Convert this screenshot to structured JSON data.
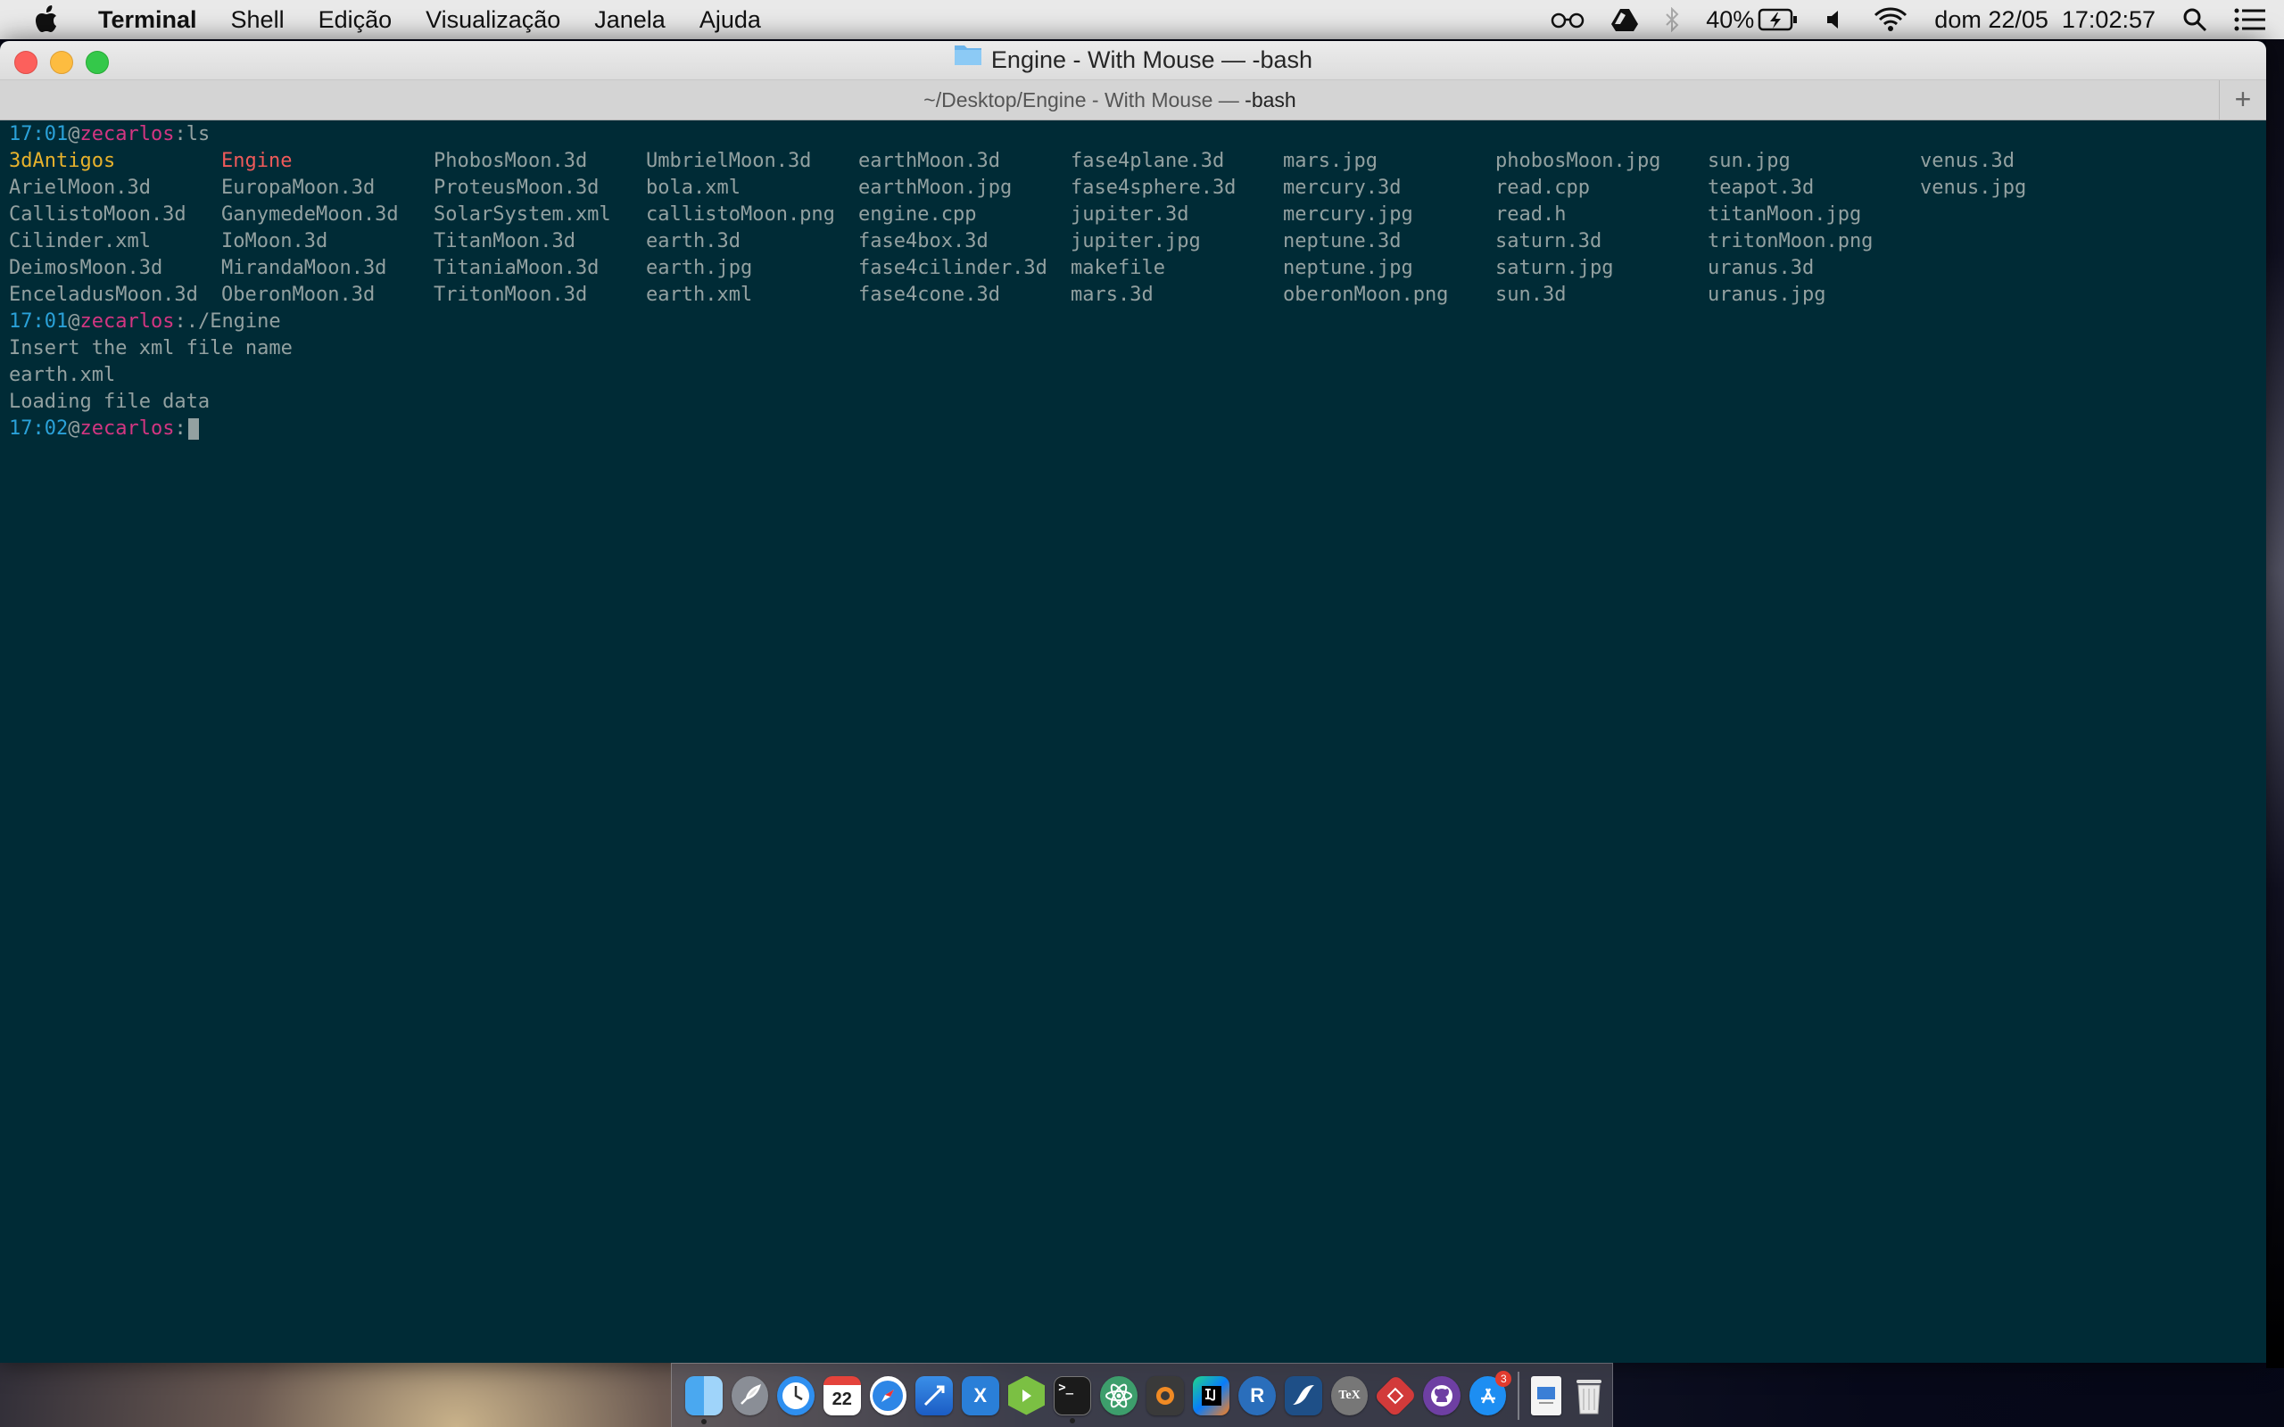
{
  "menubar": {
    "app_name": "Terminal",
    "items": [
      "Shell",
      "Edição",
      "Visualização",
      "Janela",
      "Ajuda"
    ],
    "status": {
      "battery": "40%",
      "datetime": "dom 22/05  17:02:57"
    }
  },
  "window": {
    "title": "Engine - With Mouse — -bash",
    "tab_path": "~/Desktop/Engine - With Mouse — ",
    "tab_process": "-bash",
    "tab_add": "+"
  },
  "terminal": {
    "prompt1": {
      "time": "17:01",
      "at": "@",
      "user": "zecarlos",
      "sep": ":",
      "cmd": "ls"
    },
    "ls_columns": [
      [
        "3dAntigos",
        "ArielMoon.3d",
        "CallistoMoon.3d",
        "Cilinder.xml",
        "DeimosMoon.3d",
        "EnceladusMoon.3d"
      ],
      [
        "Engine",
        "EuropaMoon.3d",
        "GanymedeMoon.3d",
        "IoMoon.3d",
        "MirandaMoon.3d",
        "OberonMoon.3d"
      ],
      [
        "PhobosMoon.3d",
        "ProteusMoon.3d",
        "SolarSystem.xml",
        "TitanMoon.3d",
        "TitaniaMoon.3d",
        "TritonMoon.3d"
      ],
      [
        "UmbrielMoon.3d",
        "bola.xml",
        "callistoMoon.png",
        "earth.3d",
        "earth.jpg",
        "earth.xml"
      ],
      [
        "earthMoon.3d",
        "earthMoon.jpg",
        "engine.cpp",
        "fase4box.3d",
        "fase4cilinder.3d",
        "fase4cone.3d"
      ],
      [
        "fase4plane.3d",
        "fase4sphere.3d",
        "jupiter.3d",
        "jupiter.jpg",
        "makefile",
        "mars.3d"
      ],
      [
        "mars.jpg",
        "mercury.3d",
        "mercury.jpg",
        "neptune.3d",
        "neptune.jpg",
        "oberonMoon.png"
      ],
      [
        "phobosMoon.jpg",
        "read.cpp",
        "read.h",
        "saturn.3d",
        "saturn.jpg",
        "sun.3d"
      ],
      [
        "sun.jpg",
        "teapot.3d",
        "titanMoon.jpg",
        "tritonMoon.png",
        "uranus.3d",
        "uranus.jpg"
      ],
      [
        "venus.3d",
        "venus.jpg",
        "",
        "",
        "",
        ""
      ]
    ],
    "prompt2": {
      "time": "17:01",
      "at": "@",
      "user": "zecarlos",
      "sep": ":",
      "cmd": "./Engine"
    },
    "output": [
      "Insert the xml file name",
      "earth.xml",
      "Loading file data"
    ],
    "prompt3": {
      "time": "17:02",
      "at": "@",
      "user": "zecarlos",
      "sep": ":",
      "cmd": ""
    }
  },
  "dock": {
    "calendar_day": "22",
    "appstore_badge": "3",
    "r_label": "R",
    "tex_label": "TeX",
    "xcode_label": "X"
  }
}
